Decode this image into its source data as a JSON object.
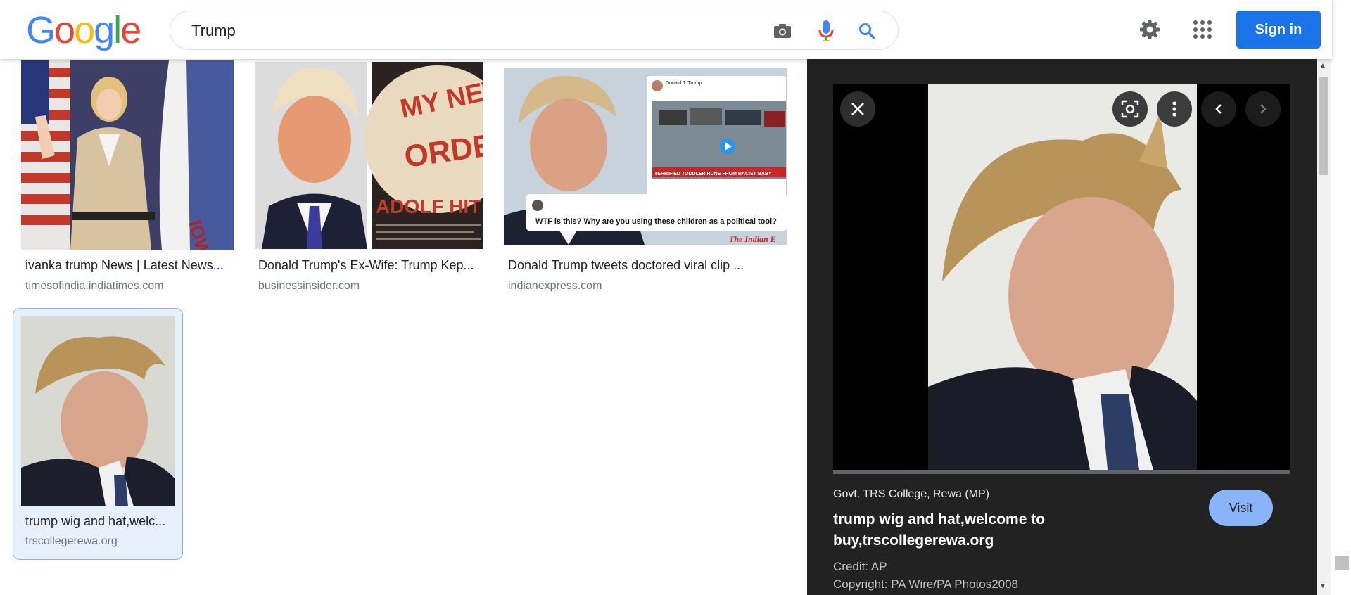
{
  "header": {
    "logo_letters": [
      "G",
      "o",
      "o",
      "g",
      "l",
      "e"
    ],
    "search_value": "Trump",
    "icons": [
      "camera-icon",
      "mic-icon",
      "search-icon",
      "settings-gear-icon",
      "apps-grid-icon"
    ],
    "sign_in_label": "Sign in"
  },
  "results": [
    {
      "title": "ivanka trump News | Latest News...",
      "source": "timesofindia.indiatimes.com"
    },
    {
      "title": "Donald Trump's Ex-Wife: Trump Kep...",
      "source": "businessinsider.com"
    },
    {
      "title": "Donald Trump tweets doctored viral clip ...",
      "source": "indianexpress.com"
    },
    {
      "title": "trump wig and hat,welc...",
      "source": "trscollegerewa.org"
    }
  ],
  "thumb_texts": {
    "flag_text": "IOWA",
    "book_text": [
      "MY NEW",
      "ORDER",
      "ADOLF HIT"
    ],
    "tweet_author": "Donald J. Trump",
    "tweet_headline": "TERRIFIED TODDLER RUNS FROM RACIST BABY",
    "tweet_reply": "WTF is this? Why are you using these children as a political tool?",
    "tweet_watermark": "The Indian E"
  },
  "panel": {
    "source": "Govt. TRS College, Rewa (MP)",
    "title": "trump wig and hat,welcome to buy,trscollegerewa.org",
    "visit_label": "Visit",
    "credit": "Credit: AP",
    "copyright": "Copyright: PA Wire/PA Photos2008"
  },
  "colors": {
    "accent": "#1a73e8",
    "panel_bg": "#222222",
    "visit_bg": "#8ab4f8"
  }
}
